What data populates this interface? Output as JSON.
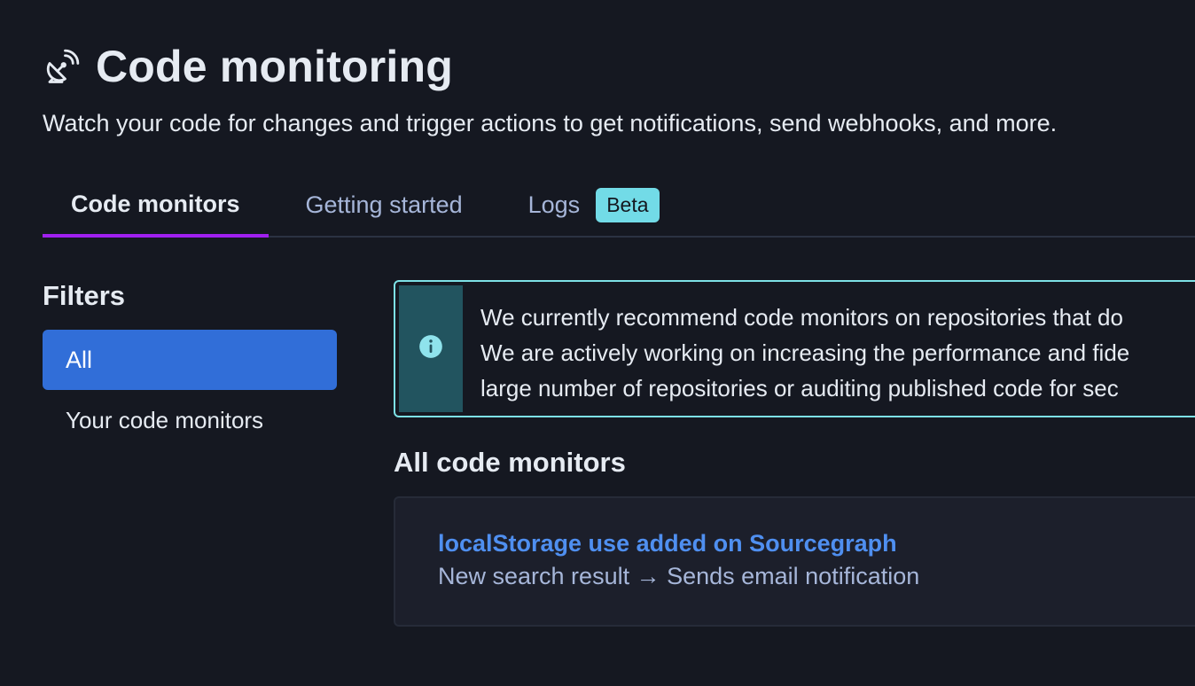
{
  "header": {
    "title": "Code monitoring",
    "subtitle": "Watch your code for changes and trigger actions to get notifications, send webhooks, and more.",
    "icon": "satellite-dish-icon"
  },
  "tabs": [
    {
      "label": "Code monitors",
      "active": true
    },
    {
      "label": "Getting started",
      "active": false
    },
    {
      "label": "Logs",
      "active": false,
      "badge": "Beta"
    }
  ],
  "filters": {
    "title": "Filters",
    "items": [
      {
        "label": "All",
        "active": true
      },
      {
        "label": "Your code monitors",
        "active": false
      }
    ]
  },
  "alert": {
    "icon": "info-icon",
    "lines": [
      "We currently recommend code monitors on repositories that do",
      "We are actively working on increasing the performance and fide",
      "large number of repositories or auditing published code for sec"
    ]
  },
  "monitors": {
    "section_title": "All code monitors",
    "items": [
      {
        "name": "localStorage use added on Sourcegraph",
        "description": "New search result → Sends email notification"
      }
    ]
  },
  "colors": {
    "background": "#151821",
    "accent_tab": "#a020f0",
    "active_filter": "#316ed8",
    "link": "#4f8ff0",
    "info_border": "#7de1e6",
    "badge": "#72dbe7"
  }
}
